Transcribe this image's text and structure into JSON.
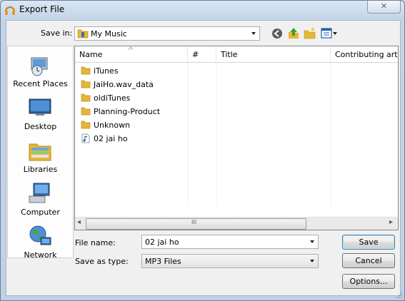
{
  "window": {
    "title": "Export File",
    "close_glyph": "✕",
    "app_icon": "headphones-icon"
  },
  "location": {
    "label": "Save in:",
    "value": "My Music",
    "toolbar_icons": [
      "back-icon",
      "up-folder-icon",
      "new-folder-icon",
      "view-menu-icon"
    ]
  },
  "places": [
    {
      "label": "Recent Places",
      "icon": "recent-places-icon"
    },
    {
      "label": "Desktop",
      "icon": "desktop-icon"
    },
    {
      "label": "Libraries",
      "icon": "libraries-icon"
    },
    {
      "label": "Computer",
      "icon": "computer-icon"
    },
    {
      "label": "Network",
      "icon": "network-icon"
    }
  ],
  "list": {
    "columns": [
      "Name",
      "#",
      "Title",
      "Contributing art"
    ],
    "items": [
      {
        "name": "iTunes",
        "type": "folder"
      },
      {
        "name": "JaiHo.wav_data",
        "type": "folder"
      },
      {
        "name": "oldiTunes",
        "type": "folder"
      },
      {
        "name": "Planning-Product",
        "type": "folder"
      },
      {
        "name": "Unknown",
        "type": "folder"
      },
      {
        "name": "02 jai ho",
        "type": "audio"
      }
    ],
    "scroll_left": "◂",
    "scroll_right": "▸",
    "thumb_grip": "III"
  },
  "form": {
    "filename_label": "File name:",
    "filename_value": "02 jai ho",
    "type_label": "Save as type:",
    "type_value": "MP3 Files"
  },
  "buttons": {
    "save": "Save",
    "cancel": "Cancel",
    "options": "Options..."
  },
  "colors": {
    "folder": "#e8b637",
    "accent": "#3c7fb1"
  }
}
